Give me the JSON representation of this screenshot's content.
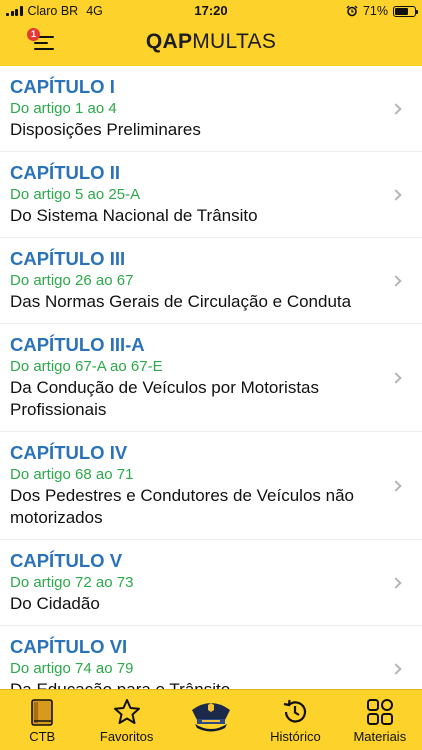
{
  "status_bar": {
    "carrier": "Claro BR",
    "network": "4G",
    "time": "17:20",
    "battery": "71%",
    "battery_level": 0.71
  },
  "header": {
    "menu_badge": "1",
    "logo_bold": "QAP",
    "logo_light": "MULTAS"
  },
  "chapters": [
    {
      "chapter": "CAPÍTULO I",
      "range": "Do artigo 1 ao 4",
      "title": "Disposições Preliminares"
    },
    {
      "chapter": "CAPÍTULO II",
      "range": "Do artigo 5 ao 25-A",
      "title": "Do Sistema Nacional de Trânsito"
    },
    {
      "chapter": "CAPÍTULO III",
      "range": "Do artigo 26 ao 67",
      "title": "Das Normas Gerais de Circulação e Conduta"
    },
    {
      "chapter": "CAPÍTULO III-A",
      "range": "Do artigo 67-A ao 67-E",
      "title": "Da Condução de Veículos por Motoristas Profissionais"
    },
    {
      "chapter": "CAPÍTULO IV",
      "range": "Do artigo 68 ao 71",
      "title": "Dos Pedestres e Condutores de Veículos não motorizados"
    },
    {
      "chapter": "CAPÍTULO V",
      "range": "Do artigo 72 ao 73",
      "title": "Do Cidadão"
    },
    {
      "chapter": "CAPÍTULO VI",
      "range": "Do artigo 74 ao 79",
      "title": "Da Educação para o Trânsito"
    }
  ],
  "tabbar": {
    "ctb": "CTB",
    "favoritos": "Favoritos",
    "historico": "Histórico",
    "materiais": "Materiais"
  },
  "colors": {
    "header_yellow": "#fdd22a",
    "chapter_blue": "#2a73b8",
    "range_green": "#2da84a"
  },
  "icons": [
    "menu-icon",
    "book-icon",
    "star-icon",
    "police-cap-icon",
    "history-icon",
    "grid-icon",
    "chevron-right-icon"
  ]
}
